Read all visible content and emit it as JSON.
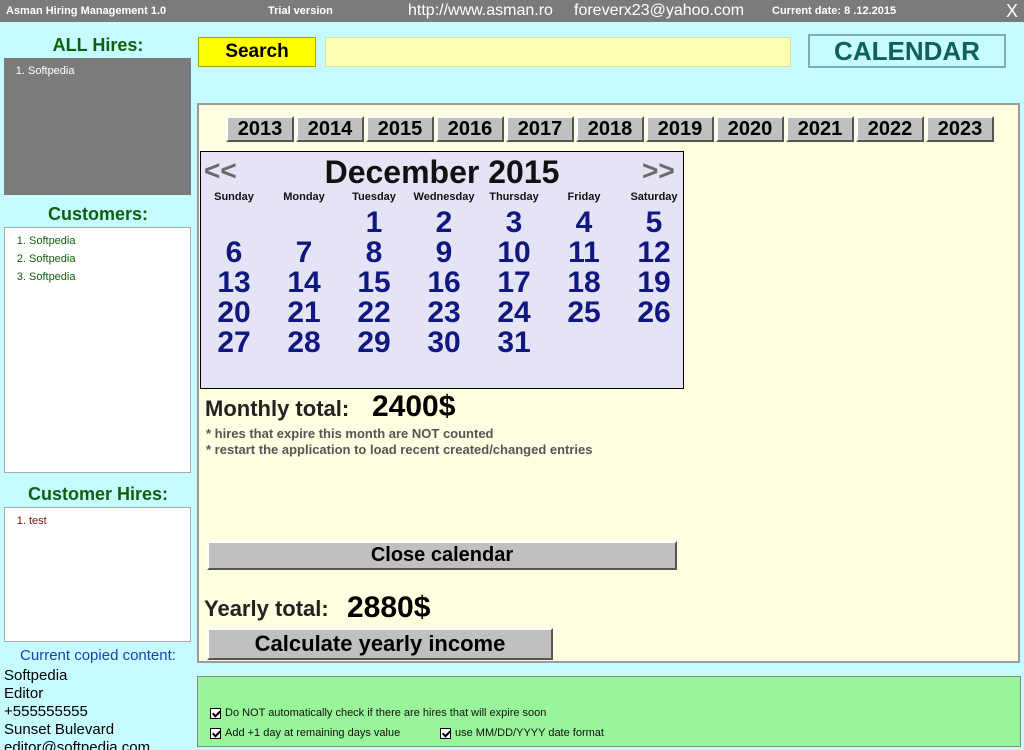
{
  "titlebar": {
    "app_name": "Asman Hiring Management 1.0",
    "trial": "Trial version",
    "website": "http://www.asman.ro",
    "email": "foreverx23@yahoo.com",
    "current_date": "Current date: 8  .12.2015",
    "close": "X"
  },
  "left": {
    "all_hires_title": "ALL Hires:",
    "all_hires": [
      "Softpedia"
    ],
    "customers_title": "Customers:",
    "customers": [
      "Softpedia",
      "Softpedia",
      "Softpedia"
    ],
    "customer_hires_title": "Customer Hires:",
    "customer_hires": [
      "test"
    ],
    "copied_title": "Current copied content:",
    "copied_lines": [
      "Softpedia",
      "Editor",
      "+555555555",
      "Sunset Bulevard",
      "editor@softpedia.com"
    ]
  },
  "toolbar": {
    "search_label": "Search",
    "search_value": "",
    "calendar_label": "CALENDAR"
  },
  "calendar": {
    "years": [
      "2013",
      "2014",
      "2015",
      "2016",
      "2017",
      "2018",
      "2019",
      "2020",
      "2021",
      "2022",
      "2023"
    ],
    "prev": "<<",
    "next": ">>",
    "month_title": "December 2015",
    "weekdays": [
      "Sunday",
      "Monday",
      "Tuesday",
      "Wednesday",
      "Thursday",
      "Friday",
      "Saturday"
    ],
    "days": [
      [
        "",
        "",
        "1",
        "2",
        "3",
        "4",
        "5"
      ],
      [
        "6",
        "7",
        "8",
        "9",
        "10",
        "11",
        "12"
      ],
      [
        "13",
        "14",
        "15",
        "16",
        "17",
        "18",
        "19"
      ],
      [
        "20",
        "21",
        "22",
        "23",
        "24",
        "25",
        "26"
      ],
      [
        "27",
        "28",
        "29",
        "30",
        "31",
        "",
        ""
      ]
    ]
  },
  "totals": {
    "monthly_label": "Monthly total:",
    "monthly_value": "2400$",
    "note1": "* hires that expire this month are NOT counted",
    "note2": "* restart the application to load recent created/changed entries",
    "close_calendar": "Close calendar",
    "yearly_label": "Yearly total:",
    "yearly_value": "2880$",
    "calc_yearly": "Calculate yearly income"
  },
  "options": {
    "opt1": "Do NOT automatically check if there are hires that will expire soon",
    "opt2": "Add +1 day at remaining days value",
    "opt3": "use MM/DD/YYYY date format"
  }
}
